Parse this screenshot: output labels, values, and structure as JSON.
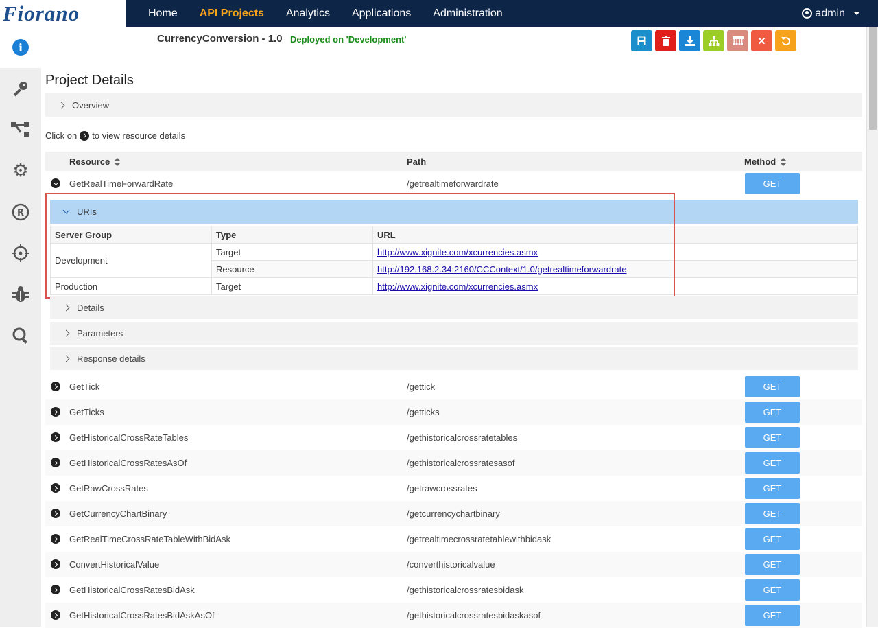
{
  "header": {
    "logo": "Fiorano",
    "nav": [
      "Home",
      "API Projects",
      "Analytics",
      "Applications",
      "Administration"
    ],
    "active_nav": "API Projects",
    "user": "admin"
  },
  "sidebar": [
    "info-icon",
    "key-icon",
    "flow-icon",
    "settings-icon",
    "registered-icon",
    "target-icon",
    "bug-icon",
    "search-icon"
  ],
  "project": {
    "title": "CurrencyConversion - 1.0",
    "status": "Deployed on 'Development'"
  },
  "toolbar": [
    {
      "name": "save-button",
      "color": "#1a8fcb"
    },
    {
      "name": "delete-button",
      "color": "#e0201b"
    },
    {
      "name": "download-button",
      "color": "#1c86d6"
    },
    {
      "name": "hierarchy-button",
      "color": "#9ccc26"
    },
    {
      "name": "deploy-button",
      "color": "#d98b80"
    },
    {
      "name": "close-button",
      "color": "#ef5a40"
    },
    {
      "name": "undo-button",
      "color": "#f7a21b"
    }
  ],
  "page": {
    "heading": "Project Details",
    "overview": "Overview",
    "hint_before": "Click on",
    "hint_after": "to view resource details"
  },
  "columns": {
    "resource": "Resource",
    "path": "Path",
    "method": "Method"
  },
  "expanded": {
    "name": "GetRealTimeForwardRate",
    "path": "/getrealtimeforwardrate",
    "method": "GET",
    "uris_label": "URIs",
    "uri_columns": [
      "Server Group",
      "Type",
      "URL"
    ],
    "uris": [
      {
        "group": "Development",
        "type": "Target",
        "url": "http://www.xignite.com/xcurrencies.asmx"
      },
      {
        "group": "",
        "type": "Resource",
        "url": "http://192.168.2.34:2160/CCContext/1.0/getrealtimeforwardrate"
      },
      {
        "group": "Production",
        "type": "Target",
        "url": "http://www.xignite.com/xcurrencies.asmx"
      }
    ],
    "sections": [
      "Details",
      "Parameters",
      "Response details"
    ]
  },
  "resources": [
    {
      "name": "GetTick",
      "path": "/gettick",
      "method": "GET"
    },
    {
      "name": "GetTicks",
      "path": "/getticks",
      "method": "GET"
    },
    {
      "name": "GetHistoricalCrossRateTables",
      "path": "/gethistoricalcrossratetables",
      "method": "GET"
    },
    {
      "name": "GetHistoricalCrossRatesAsOf",
      "path": "/gethistoricalcrossratesasof",
      "method": "GET"
    },
    {
      "name": "GetRawCrossRates",
      "path": "/getrawcrossrates",
      "method": "GET"
    },
    {
      "name": "GetCurrencyChartBinary",
      "path": "/getcurrencychartbinary",
      "method": "GET"
    },
    {
      "name": "GetRealTimeCrossRateTableWithBidAsk",
      "path": "/getrealtimecrossratetablewithbidask",
      "method": "GET"
    },
    {
      "name": "ConvertHistoricalValue",
      "path": "/converthistoricalvalue",
      "method": "GET"
    },
    {
      "name": "GetHistoricalCrossRatesBidAsk",
      "path": "/gethistoricalcrossratesbidask",
      "method": "GET"
    },
    {
      "name": "GetHistoricalCrossRatesBidAskAsOf",
      "path": "/gethistoricalcrossratesbidaskasof",
      "method": "GET"
    }
  ]
}
